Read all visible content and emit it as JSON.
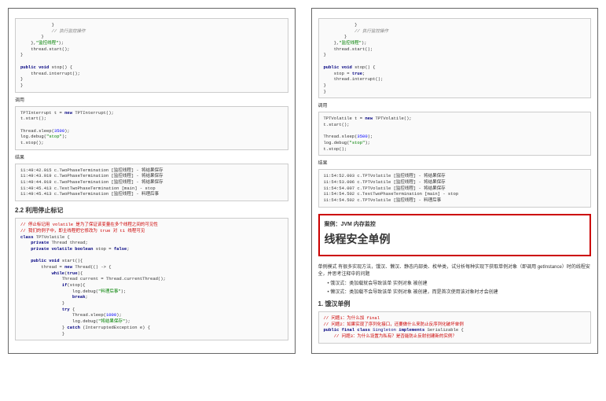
{
  "left": {
    "code1": "            }\n            // 执行监控操作\n        }\n    },\"监控线程\");\n    thread.start();\n}\n\npublic void stop() {\n    thread.interrupt();\n}\n}",
    "label_call": "调用",
    "code2": "TPTInterrupt t = new TPTInterrupt();\nt.start();\n\nThread.sleep(3500);\nlog.debug(\"stop\");\nt.stop();",
    "label_result": "结果",
    "code3": "11:49:42.915 c.TwoPhaseTermination [监控线程] - 将结果保存\n11:49:43.919 c.TwoPhaseTermination [监控线程] - 将结果保存\n11:49:44.919 c.TwoPhaseTermination [监控线程] - 将结果保存\n11:49:45.413 c.TestTwoPhaseTermination [main] - stop\n11:49:45.413 c.TwoPhaseTermination [监控线程] - 料理后事",
    "sec_title": "2.2 利用停止标记",
    "code4": "// 停止标记用 volatile 是为了保证该变量在多个线程之间的可见性\n// 我们的例子中，即主线程把它修改为 true 对 t1 线程可见\nclass TPTVolatile {\n    private Thread thread;\n    private volatile boolean stop = false;\n\n    public void start(){\n        thread = new Thread(() -> {\n            while(true){\n                Thread current = Thread.currentThread();\n                if(stop){\n                    log.debug(\"料理后事\");\n                    break;\n                }\n                try {\n                    Thread.sleep(1000);\n                    log.debug(\"将结果保存\");\n                } catch (InterruptedException e) {\n                }"
  },
  "right": {
    "code1": "            }\n            // 执行监控操作\n        }\n    },\"监控线程\");\n    thread.start();\n}\n\npublic void stop() {\n    stop = true;\n    thread.interrupt();\n}\n}",
    "label_call": "调用",
    "code2": "TPTVolatile t = new TPTVolatile();\nt.start();\n\nThread.sleep(3500);\nlog.debug(\"stop\");\nt.stop();",
    "label_result": "结果",
    "code3": "11:54:52.003 c.TPTVolatile [监控线程] - 将结果保存\n11:54:53.006 c.TPTVolatile [监控线程] - 将结果保存\n11:54:54.007 c.TPTVolatile [监控线程] - 将结果保存\n11:54:54.502 c.TestTwoPhaseTermination [main] - stop\n11:54:54.502 c.TPTVolatile [监控线程] - 料理后事",
    "box_title": "案例：JVM 内存监控",
    "box_big": "线程安全单例",
    "para1": "单例模式 有很多实现方法，饿汉、懒汉、静态内部类、枚举类，试分析每种实现下获取单例对象（即调用 getInstance）时的线程安全，并思考注释中的问题",
    "bullet1": "饿汉式：类加载就会导致该单 实例对象 被创建",
    "bullet2": "懒汉式：类加载不会导致该单 实例对象 被创建，而是首次使用该对象时才会创建",
    "sec_title": "1. 饿汉单例",
    "code4": "// 问题1：为什么加 final\n// 问题2：如果实现了序列化接口，还要做什么来防止反序列化破坏单例\npublic final class Singleton implements Serializable {\n    // 问题3：为什么设置为私有？是否能防止反射创建新的实例？"
  }
}
